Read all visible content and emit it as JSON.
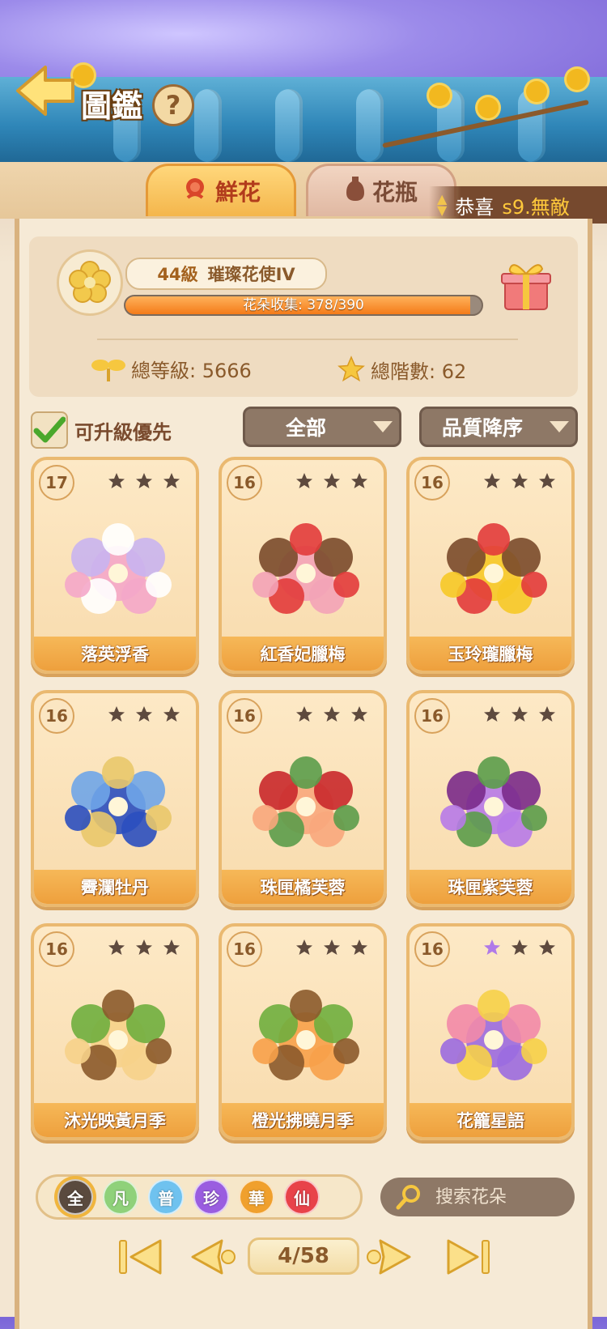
{
  "header": {
    "title": "圖鑑",
    "help": "?"
  },
  "tabs": [
    {
      "label": "鮮花",
      "icon": "rose-icon",
      "active": true
    },
    {
      "label": "花瓶",
      "icon": "vase-icon",
      "active": false
    }
  ],
  "ticker": {
    "prefix": "恭喜",
    "highlight": "s9.無敵"
  },
  "profile": {
    "level": "44級",
    "rank": "璀璨花使IV",
    "progress_text": "花朵收集: 378/390",
    "progress": 0.969,
    "total_level_label": "總等級: 5666",
    "total_stars_label": "總階數: 62"
  },
  "filters": {
    "priority_label": "可升級優先",
    "priority_checked": true,
    "category": "全部",
    "sort": "品質降序"
  },
  "cards": [
    {
      "num": "17",
      "name": "落英浮香",
      "palette": [
        "#f4a7c9",
        "#c9b4f0",
        "#ffffff"
      ]
    },
    {
      "num": "16",
      "name": "紅香妃臘梅",
      "palette": [
        "#f3a3b7",
        "#7a4a2b",
        "#e23b3b"
      ]
    },
    {
      "num": "16",
      "name": "玉玲瓏臘梅",
      "palette": [
        "#f6c927",
        "#7a4a2b",
        "#e23b3b"
      ]
    },
    {
      "num": "16",
      "name": "霽瀾牡丹",
      "palette": [
        "#2b4fbf",
        "#6fa5e8",
        "#e9c86a"
      ]
    },
    {
      "num": "16",
      "name": "珠匣橘芙蓉",
      "palette": [
        "#f8a77c",
        "#c9282b",
        "#5b9c4a"
      ]
    },
    {
      "num": "16",
      "name": "珠匣紫芙蓉",
      "palette": [
        "#b77ae8",
        "#7a2a8a",
        "#5b9c4a"
      ]
    },
    {
      "num": "16",
      "name": "沐光映黃月季",
      "palette": [
        "#f6d28a",
        "#6fae3e",
        "#8b5a2b"
      ]
    },
    {
      "num": "16",
      "name": "橙光拂曉月季",
      "palette": [
        "#f7a14a",
        "#6fae3e",
        "#8b5a2b"
      ]
    },
    {
      "num": "16",
      "name": "花籠星語",
      "palette": [
        "#9b6be0",
        "#f28aa8",
        "#f6d048"
      ]
    }
  ],
  "rarity": [
    {
      "label": "全",
      "color": "#5a4a3e",
      "selected": true
    },
    {
      "label": "凡",
      "color": "#8fd17a",
      "selected": false
    },
    {
      "label": "普",
      "color": "#6fc2ef",
      "selected": false
    },
    {
      "label": "珍",
      "color": "#9a5de0",
      "selected": false
    },
    {
      "label": "華",
      "color": "#f0a02d",
      "selected": false
    },
    {
      "label": "仙",
      "color": "#e8424a",
      "selected": false
    }
  ],
  "search": {
    "placeholder": "搜索花朵"
  },
  "pager": {
    "current": "4/58"
  }
}
